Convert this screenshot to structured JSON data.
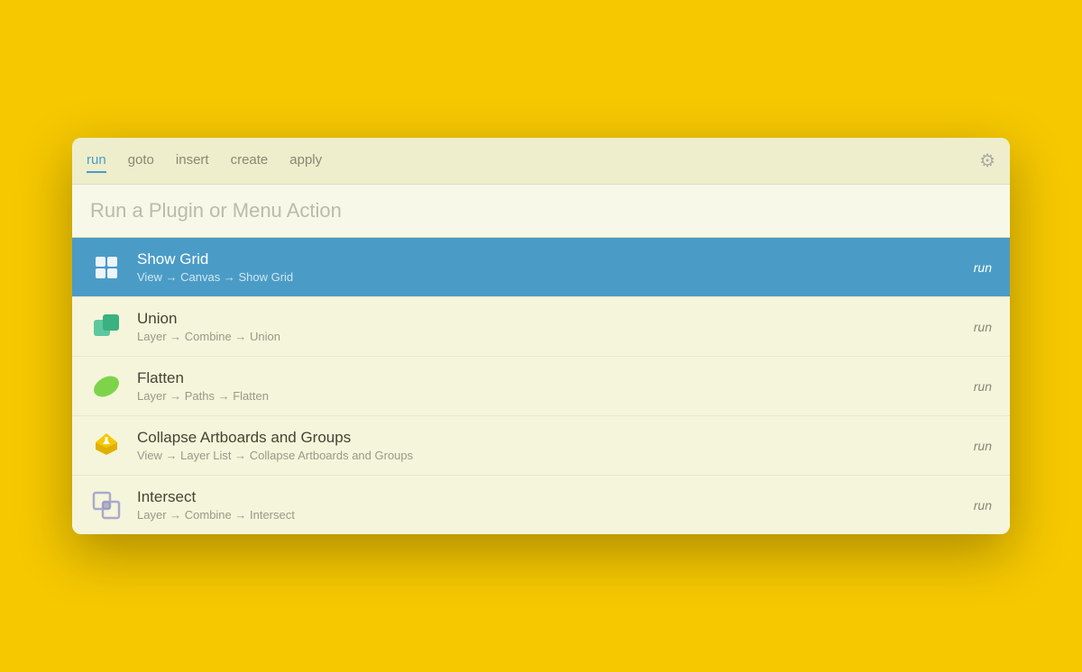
{
  "background_color": "#F5C800",
  "dialog": {
    "tabs": [
      {
        "id": "run",
        "label": "run",
        "active": true
      },
      {
        "id": "goto",
        "label": "goto",
        "active": false
      },
      {
        "id": "insert",
        "label": "insert",
        "active": false
      },
      {
        "id": "create",
        "label": "create",
        "active": false
      },
      {
        "id": "apply",
        "label": "apply",
        "active": false
      }
    ],
    "search": {
      "placeholder": "Run a Plugin or Menu Action",
      "value": ""
    },
    "results": [
      {
        "id": "show-grid",
        "title": "Show Grid",
        "path": "View → Canvas → Show Grid",
        "run_label": "run",
        "selected": true
      },
      {
        "id": "union",
        "title": "Union",
        "path": "Layer → Combine → Union",
        "run_label": "run",
        "selected": false
      },
      {
        "id": "flatten",
        "title": "Flatten",
        "path": "Layer → Paths → Flatten",
        "run_label": "run",
        "selected": false
      },
      {
        "id": "collapse-artboards",
        "title": "Collapse Artboards and Groups",
        "path": "View → Layer List → Collapse Artboards and Groups",
        "run_label": "run",
        "selected": false
      },
      {
        "id": "intersect",
        "title": "Intersect",
        "path": "Layer → Combine → Intersect",
        "run_label": "run",
        "selected": false
      }
    ]
  }
}
